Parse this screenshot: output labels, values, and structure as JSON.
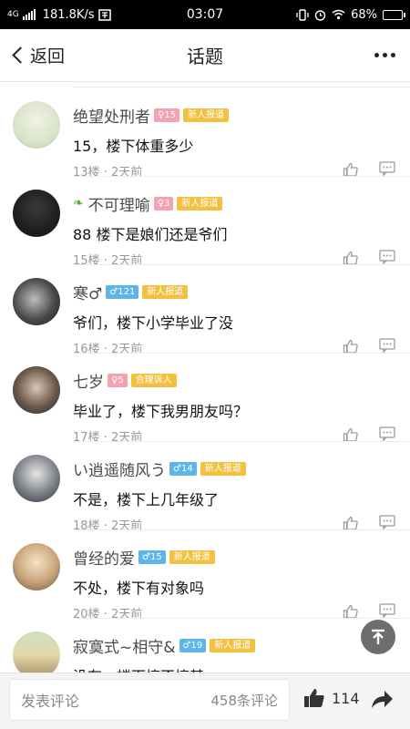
{
  "status_bar": {
    "network": "4G",
    "speed": "181.8K/s",
    "time": "03:07",
    "battery": "68%",
    "battery_level": 0.68
  },
  "nav": {
    "back_label": "返回",
    "title": "话题"
  },
  "comments": [
    {
      "username": "绝望处刑者",
      "gender_badge": "♀15",
      "gender": "female",
      "title_badge": "新人报道",
      "text": "15，楼下体重多少",
      "floor": "13楼",
      "time": "2天前"
    },
    {
      "username": "不可理喻",
      "gender_badge": "♀3",
      "gender": "female",
      "title_badge": "新人报道",
      "text": "88  楼下是娘们还是爷们",
      "floor": "15楼",
      "time": "2天前"
    },
    {
      "username": "寒♂",
      "gender_badge": "♂121",
      "gender": "male",
      "title_badge": "新人报道",
      "text": "爷们，楼下小学毕业了没",
      "floor": "16楼",
      "time": "2天前"
    },
    {
      "username": "七岁",
      "gender_badge": "♀5",
      "gender": "female",
      "title_badge": "合理诉人",
      "text": "毕业了，楼下我男朋友吗？",
      "floor": "17楼",
      "time": "2天前"
    },
    {
      "username": "い逍遥随风う",
      "gender_badge": "♂14",
      "gender": "male",
      "title_badge": "新人报道",
      "text": "不是，楼下上几年级了",
      "floor": "18楼",
      "time": "2天前"
    },
    {
      "username": "曾经的爱",
      "gender_badge": "♂15",
      "gender": "male",
      "title_badge": "新人报道",
      "text": "不处，楼下有对象吗",
      "floor": "20楼",
      "time": "2天前"
    },
    {
      "username": "寂寞式~相守&",
      "gender_badge": "♂19",
      "gender": "male",
      "title_badge": "新人报道",
      "text": "没有，楼下搞不搞基",
      "floor": "",
      "time": ""
    }
  ],
  "bottom_bar": {
    "input_placeholder": "发表评论",
    "comment_count": "458条评论",
    "like_count": "114"
  },
  "icons": {
    "back": "chevron-left-icon",
    "more": "more-dots-icon",
    "like": "thumbs-up-icon",
    "reply": "comment-bubble-icon",
    "scroll_top": "arrow-up-to-top-icon",
    "share": "share-arrow-icon"
  },
  "colors": {
    "female_badge": "#f4a2b0",
    "male_badge": "#5db5e8",
    "title_badge": "#f2c13f",
    "meta_text": "#999999"
  }
}
